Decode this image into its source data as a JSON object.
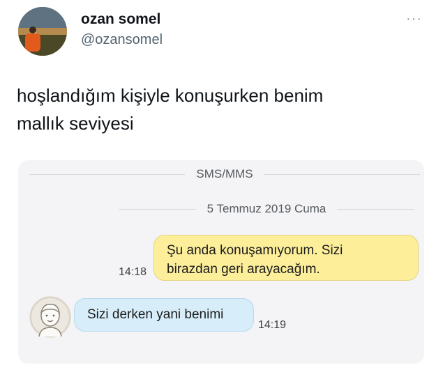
{
  "author": {
    "name": "ozan somel",
    "handle": "@ozansomel"
  },
  "more_icon": "···",
  "tweet": {
    "text_line1": "hoşlandığım kişiyle konuşurken benim",
    "text_line2": "mallık seviyesi"
  },
  "media": {
    "header": "SMS/MMS",
    "date": "5 Temmuz 2019 Cuma",
    "messages": [
      {
        "direction": "outgoing",
        "line1": "Şu anda konuşamıyorum. Sizi",
        "line2": "birazdan geri arayacağım.",
        "time": "14:18"
      },
      {
        "direction": "incoming",
        "text": "Sizi derken yani benimi",
        "time": "14:19"
      }
    ]
  },
  "colors": {
    "outgoing_bubble": "#fdee9a",
    "incoming_bubble": "#d7eefa",
    "media_background": "#f4f4f6"
  }
}
